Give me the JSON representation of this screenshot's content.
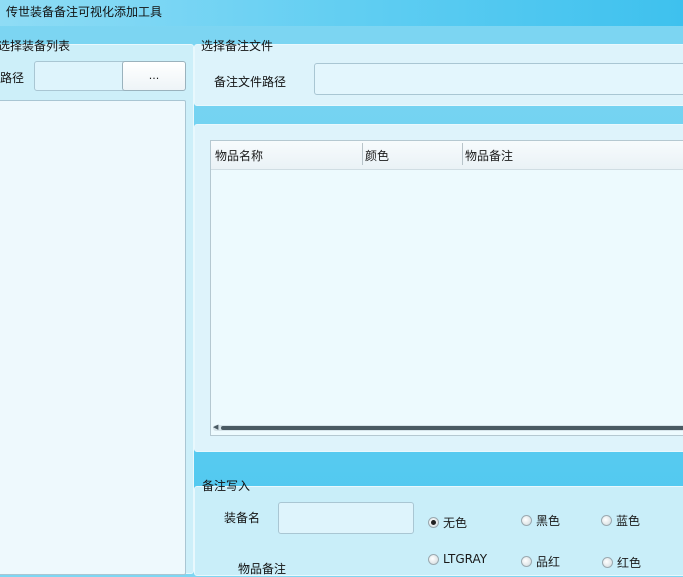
{
  "window": {
    "title": "传世装备备注可视化添加工具"
  },
  "left_panel": {
    "group_label": "选择装备列表",
    "path_label": "路径",
    "path_value": "",
    "browse_label": "..."
  },
  "right_top": {
    "group_label": "选择备注文件",
    "path_label": "备注文件路径",
    "path_value": ""
  },
  "table": {
    "columns": [
      "物品名称",
      "颜色",
      "物品备注"
    ],
    "rows": []
  },
  "note_write": {
    "group_label": "备注写入",
    "name_label": "装备名",
    "name_value": "",
    "note_label": "物品备注",
    "colors": [
      {
        "label": "无色",
        "selected": true
      },
      {
        "label": "黑色",
        "selected": false
      },
      {
        "label": "蓝色",
        "selected": false
      },
      {
        "label": "LTGRAY",
        "selected": false
      },
      {
        "label": "品红",
        "selected": false
      },
      {
        "label": "红色",
        "selected": false
      }
    ]
  }
}
